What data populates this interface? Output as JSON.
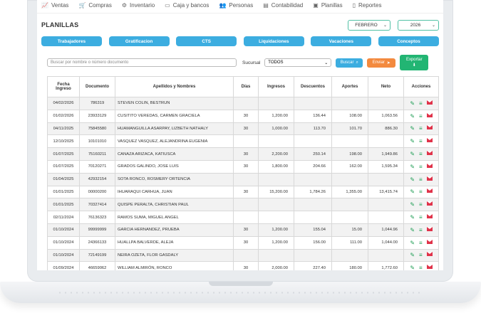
{
  "menu": [
    {
      "label": "Ventas",
      "icon": "chart-icon"
    },
    {
      "label": "Compras",
      "icon": "cart-icon"
    },
    {
      "label": "Inventario",
      "icon": "boxes-icon"
    },
    {
      "label": "Caja y bancos",
      "icon": "cash-icon"
    },
    {
      "label": "Personas",
      "icon": "people-icon"
    },
    {
      "label": "Contabilidad",
      "icon": "ledger-icon"
    },
    {
      "label": "Planillas",
      "icon": "payroll-icon"
    },
    {
      "label": "Reportes",
      "icon": "document-icon"
    }
  ],
  "page_title": "PLANILLAS",
  "period": {
    "month": "FEBRERO",
    "year": "2026"
  },
  "tabs": [
    "Trabajadores",
    "Gratificacion",
    "CTS",
    "Liquidaciones",
    "Vacaciones",
    "Conceptos"
  ],
  "filters": {
    "search_placeholder": "Buscar por nombre o número documento",
    "sucursal_label": "Sucursal",
    "sucursal_value": "TODOS",
    "buscar_label": "Buscar",
    "enviar_label": "Enviar",
    "exportar_label": "Exportar"
  },
  "table": {
    "headers": [
      "Fecha Ingreso",
      "Documento",
      "Apellidos y Nombres",
      "Días",
      "Ingresos",
      "Descuentos",
      "Aportes",
      "Neto",
      "Acciones"
    ],
    "rows": [
      {
        "fecha": "04/02/2026",
        "doc": "786319",
        "nombre": "STEVEN COLIN, BESTRUN",
        "dias": "",
        "ingresos": "",
        "descuentos": "",
        "aportes": "",
        "neto": ""
      },
      {
        "fecha": "01/02/2026",
        "doc": "23933129",
        "nombre": "CUSITITO VEREDAS, CARMEN GRACIELA",
        "dias": "30",
        "ingresos": "1,200.00",
        "descuentos": "136.44",
        "aportes": "108.00",
        "neto": "1,063.56"
      },
      {
        "fecha": "04/11/2025",
        "doc": "75845580",
        "nombre": "HUAMANGUILLA ASARPAY, LIZBETH NATHALY",
        "dias": "30",
        "ingresos": "1,000.00",
        "descuentos": "113.70",
        "aportes": "101.70",
        "neto": "886.30"
      },
      {
        "fecha": "12/10/2025",
        "doc": "10101010",
        "nombre": "VASQUEZ VASQUEZ, ALEJANDRINA EUGENIA",
        "dias": "",
        "ingresos": "",
        "descuentos": "",
        "aportes": "",
        "neto": ""
      },
      {
        "fecha": "01/07/2025",
        "doc": "75160211",
        "nombre": "CANAZA ARIZACA, KATIUSCA",
        "dias": "30",
        "ingresos": "2,200.00",
        "descuentos": "250.14",
        "aportes": "198.00",
        "neto": "1,949.86"
      },
      {
        "fecha": "01/07/2025",
        "doc": "70120271",
        "nombre": "GRADOS GALINDO, JOSE LUIS",
        "dias": "30",
        "ingresos": "1,800.00",
        "descuentos": "204.66",
        "aportes": "162.00",
        "neto": "1,595.34"
      },
      {
        "fecha": "01/04/2025",
        "doc": "42932154",
        "nombre": "SOTA RONCO, ROSMERY ORTENCIA",
        "dias": "",
        "ingresos": "",
        "descuentos": "",
        "aportes": "",
        "neto": ""
      },
      {
        "fecha": "01/01/2025",
        "doc": "00000200",
        "nombre": "IHUARAQUI CARHUA, JUAN",
        "dias": "30",
        "ingresos": "15,200.00",
        "descuentos": "1,784.26",
        "aportes": "1,355.00",
        "neto": "13,415.74"
      },
      {
        "fecha": "01/01/2025",
        "doc": "70327414",
        "nombre": "QUISPE PERALTA, CHRISTIAN PAUL",
        "dias": "",
        "ingresos": "",
        "descuentos": "",
        "aportes": "",
        "neto": ""
      },
      {
        "fecha": "02/11/2024",
        "doc": "76136323",
        "nombre": "RAMOS SUMA, MIGUEL ANGEL",
        "dias": "",
        "ingresos": "",
        "descuentos": "",
        "aportes": "",
        "neto": ""
      },
      {
        "fecha": "01/10/2024",
        "doc": "99999999",
        "nombre": "GARCIA HERNANDEZ, PRUEBA",
        "dias": "30",
        "ingresos": "1,200.00",
        "descuentos": "155.04",
        "aportes": "15.00",
        "neto": "1,044.96"
      },
      {
        "fecha": "01/10/2024",
        "doc": "24366133",
        "nombre": "HUALLPA BALVERDE, ALEJA",
        "dias": "30",
        "ingresos": "1,200.00",
        "descuentos": "156.00",
        "aportes": "111.00",
        "neto": "1,044.00"
      },
      {
        "fecha": "01/10/2024",
        "doc": "72149199",
        "nombre": "NEIRA OZETA, FLOR GASDALY",
        "dias": "",
        "ingresos": "",
        "descuentos": "",
        "aportes": "",
        "neto": ""
      },
      {
        "fecha": "01/09/2024",
        "doc": "46659062",
        "nombre": "WILLIAM ALMIRÓN, RONCO",
        "dias": "30",
        "ingresos": "2,000.00",
        "descuentos": "227.40",
        "aportes": "180.00",
        "neto": "1,772.60"
      }
    ]
  },
  "colors": {
    "tab": "#3cade0",
    "buscar": "#3cade0",
    "enviar": "#f38a3f",
    "exportar": "#22b573",
    "mail": "#e0334a",
    "edit": "#1f9d55"
  }
}
